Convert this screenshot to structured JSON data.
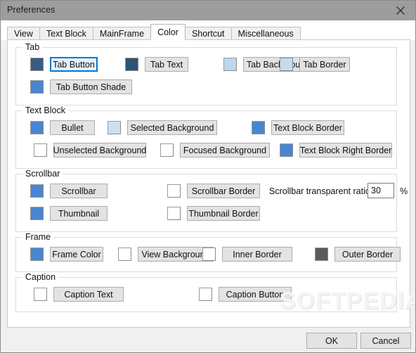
{
  "window": {
    "title": "Preferences",
    "close_icon": "close-icon"
  },
  "tabs": [
    {
      "label": "View",
      "active": false
    },
    {
      "label": "Text Block",
      "active": false
    },
    {
      "label": "MainFrame",
      "active": false
    },
    {
      "label": "Color",
      "active": true
    },
    {
      "label": "Shortcut",
      "active": false
    },
    {
      "label": "Miscellaneous",
      "active": false
    }
  ],
  "groups": [
    {
      "title": "Tab",
      "rows": [
        [
          {
            "swatch": "#3a5b80",
            "label": "Tab Button",
            "focused": true
          },
          {
            "swatch": "#2f5473",
            "label": "Tab Text",
            "focused": false
          },
          {
            "swatch": "#bdd7ee",
            "label": "Tab Background",
            "focused": false
          },
          {
            "swatch": "#c3dcf2",
            "label": "Tab Border",
            "focused": false
          }
        ],
        [
          {
            "swatch": "#4a86d0",
            "label": "Tab Button Shade",
            "focused": false
          }
        ]
      ]
    },
    {
      "title": "Text Block",
      "rows": [
        [
          {
            "swatch": "#4a86d0",
            "label": "Bullet",
            "focused": false
          },
          {
            "swatch": "#cce0f5",
            "label": "Selected Background",
            "focused": false
          },
          {
            "swatch": "#4a86d0",
            "label": "Text Block Border",
            "focused": false
          }
        ],
        [
          {
            "swatch": "#ffffff",
            "label": "Unselected Background",
            "focused": false
          },
          {
            "swatch": "#ffffff",
            "label": "Focused Background",
            "focused": false
          },
          {
            "swatch": "#4a86d0",
            "label": "Text Block Right Border",
            "focused": false
          }
        ]
      ]
    },
    {
      "title": "Scrollbar",
      "rows": [
        [
          {
            "swatch": "#4a86d0",
            "label": "Scrollbar",
            "focused": false
          },
          {
            "swatch": "#ffffff",
            "label": "Scrollbar Border",
            "focused": false
          }
        ],
        [
          {
            "swatch": "#4a86d0",
            "label": "Thumbnail",
            "focused": false
          },
          {
            "swatch": "#ffffff",
            "label": "Thumbnail Border",
            "focused": false
          }
        ]
      ],
      "ratio": {
        "label": "Scrollbar transparent ratio:",
        "value": "30",
        "unit": "%"
      }
    },
    {
      "title": "Frame",
      "rows": [
        [
          {
            "swatch": "#4a86d0",
            "label": "Frame Color",
            "focused": false
          },
          {
            "swatch": "#ffffff",
            "label": "View Background",
            "focused": false
          },
          {
            "swatch": "#ffffff",
            "label": "Inner Border",
            "focused": false
          },
          {
            "swatch": "#5a5a5a",
            "label": "Outer Border",
            "focused": false
          }
        ]
      ]
    },
    {
      "title": "Caption",
      "rows": [
        [
          {
            "swatch": "#ffffff",
            "label": "Caption Text",
            "focused": false
          },
          {
            "swatch": "#ffffff",
            "label": "Caption Button",
            "focused": false
          }
        ]
      ]
    }
  ],
  "footer": {
    "ok_label": "OK",
    "cancel_label": "Cancel"
  },
  "watermark": {
    "text": "SOFTPEDIA",
    "mark": "®"
  }
}
